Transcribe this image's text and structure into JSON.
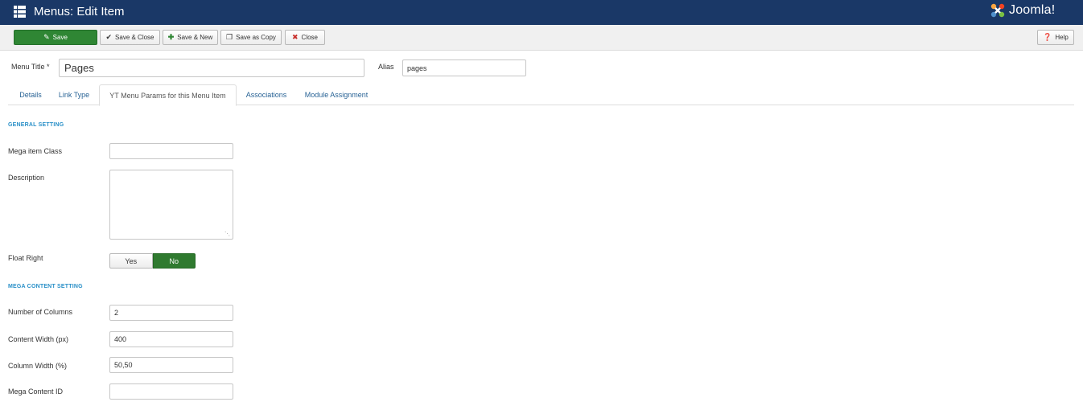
{
  "header": {
    "title": "Menus: Edit Item",
    "logo_text": "Joomla!"
  },
  "toolbar": {
    "save": "Save",
    "save_close": "Save & Close",
    "save_new": "Save & New",
    "save_copy": "Save as Copy",
    "close": "Close",
    "help": "Help"
  },
  "title_row": {
    "menu_title_label": "Menu Title *",
    "menu_title_value": "Pages",
    "alias_label": "Alias",
    "alias_value": "pages"
  },
  "tabs": [
    {
      "label": "Details",
      "active": false
    },
    {
      "label": "Link Type",
      "active": false
    },
    {
      "label": "YT Menu Params for this Menu Item",
      "active": true
    },
    {
      "label": "Associations",
      "active": false
    },
    {
      "label": "Module Assignment",
      "active": false
    }
  ],
  "general": {
    "heading": "GENERAL SETTING",
    "mega_item_class_label": "Mega item Class",
    "mega_item_class_value": "",
    "description_label": "Description",
    "description_value": "",
    "float_right_label": "Float Right",
    "float_right_yes": "Yes",
    "float_right_no": "No",
    "float_right_selected": "No"
  },
  "mega": {
    "heading": "MEGA CONTENT SETTING",
    "columns_label": "Number of Columns",
    "columns_value": "2",
    "content_width_label": "Content Width (px)",
    "content_width_value": "400",
    "column_width_label": "Column Width (%)",
    "column_width_value": "50,50",
    "content_id_label": "Mega Content ID",
    "content_id_value": ""
  },
  "colors": {
    "header_bg": "#1a3867",
    "save_green": "#2f8634",
    "toggle_no": "#2f7a2f",
    "section_blue": "#2a90c8",
    "tab_link": "#2a6496"
  }
}
